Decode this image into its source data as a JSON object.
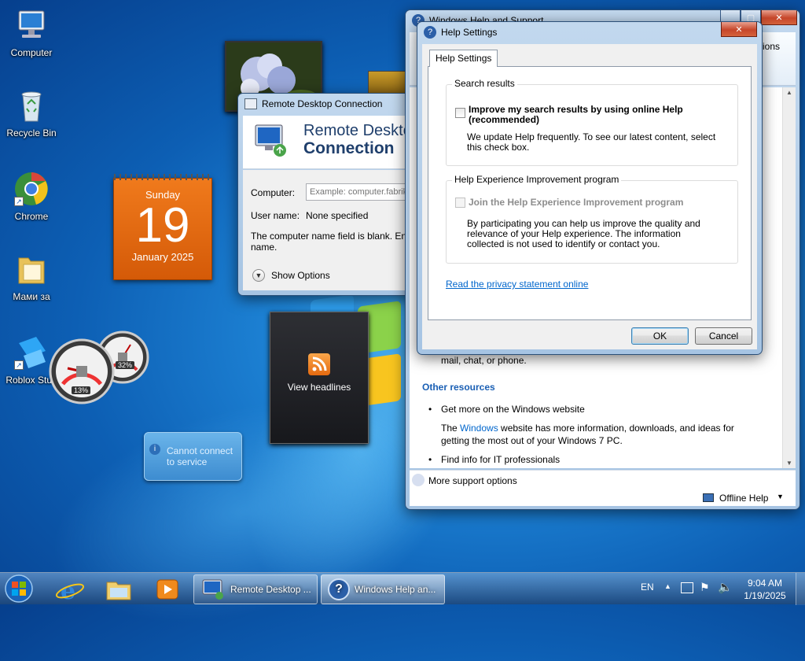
{
  "desktop_icons": [
    {
      "name": "computer",
      "label": "Computer"
    },
    {
      "name": "recycle-bin",
      "label": "Recycle Bin"
    },
    {
      "name": "chrome",
      "label": "Chrome"
    },
    {
      "name": "folder",
      "label": "Мами за"
    },
    {
      "name": "roblox",
      "label": "Roblox Stud"
    }
  ],
  "calendar": {
    "day_name": "Sunday",
    "day": "19",
    "month_year": "January 2025"
  },
  "cpu_meter": {
    "cpu": "13%",
    "mem": "32%",
    "cpu_level": 0.13,
    "mem_level": 0.32
  },
  "feed_gadget": {
    "label": "View headlines"
  },
  "weather_gadget": {
    "message": "Cannot connect to service"
  },
  "rdc": {
    "title": "Remote Desktop Connection",
    "banner_line1": "Remote Deskto",
    "banner_line2": "Connection",
    "computer_label": "Computer:",
    "computer_placeholder": "Example: computer.fabrik",
    "username_label": "User name:",
    "username_value": "None specified",
    "message": "The computer name field is blank. Enter a",
    "message2": "name.",
    "show_options": "Show Options"
  },
  "help_window": {
    "title": "Windows Help and Support",
    "options_label": "tions",
    "body_line": "mail, chat, or phone.",
    "other_resources": "Other resources",
    "bullet1": "Get more on the Windows website",
    "para_pre": "The ",
    "para_link": "Windows",
    "para_post": " website has more information, downloads, and ideas for",
    "para_line2": "getting the most out of your Windows 7 PC.",
    "bullet2": "Find info for IT professionals",
    "more_support": "More support options",
    "offline_help": "Offline Help"
  },
  "help_settings": {
    "title": "Help Settings",
    "tab": "Help Settings",
    "group1_title": "Search results",
    "checkbox1_label": "Improve my search results by using online Help",
    "checkbox1_label2": "(recommended)",
    "checkbox1_checked": false,
    "group1_desc1": "We update Help frequently. To see our latest content, select",
    "group1_desc2": "this check box.",
    "group2_title": "Help Experience Improvement program",
    "checkbox2_label": "Join the Help Experience Improvement program",
    "checkbox2_checked": false,
    "group2_desc1": "By participating you can help us improve the quality and",
    "group2_desc2": "relevance of your Help experience. The information",
    "group2_desc3": "collected is not used to identify or contact you.",
    "privacy_link": "Read the privacy statement online",
    "ok": "OK",
    "cancel": "Cancel"
  },
  "taskbar": {
    "tasks": [
      {
        "label": "Remote Desktop ..."
      },
      {
        "label": "Windows Help an..."
      }
    ],
    "language": "EN",
    "time": "9:04 AM",
    "date": "1/19/2025"
  }
}
